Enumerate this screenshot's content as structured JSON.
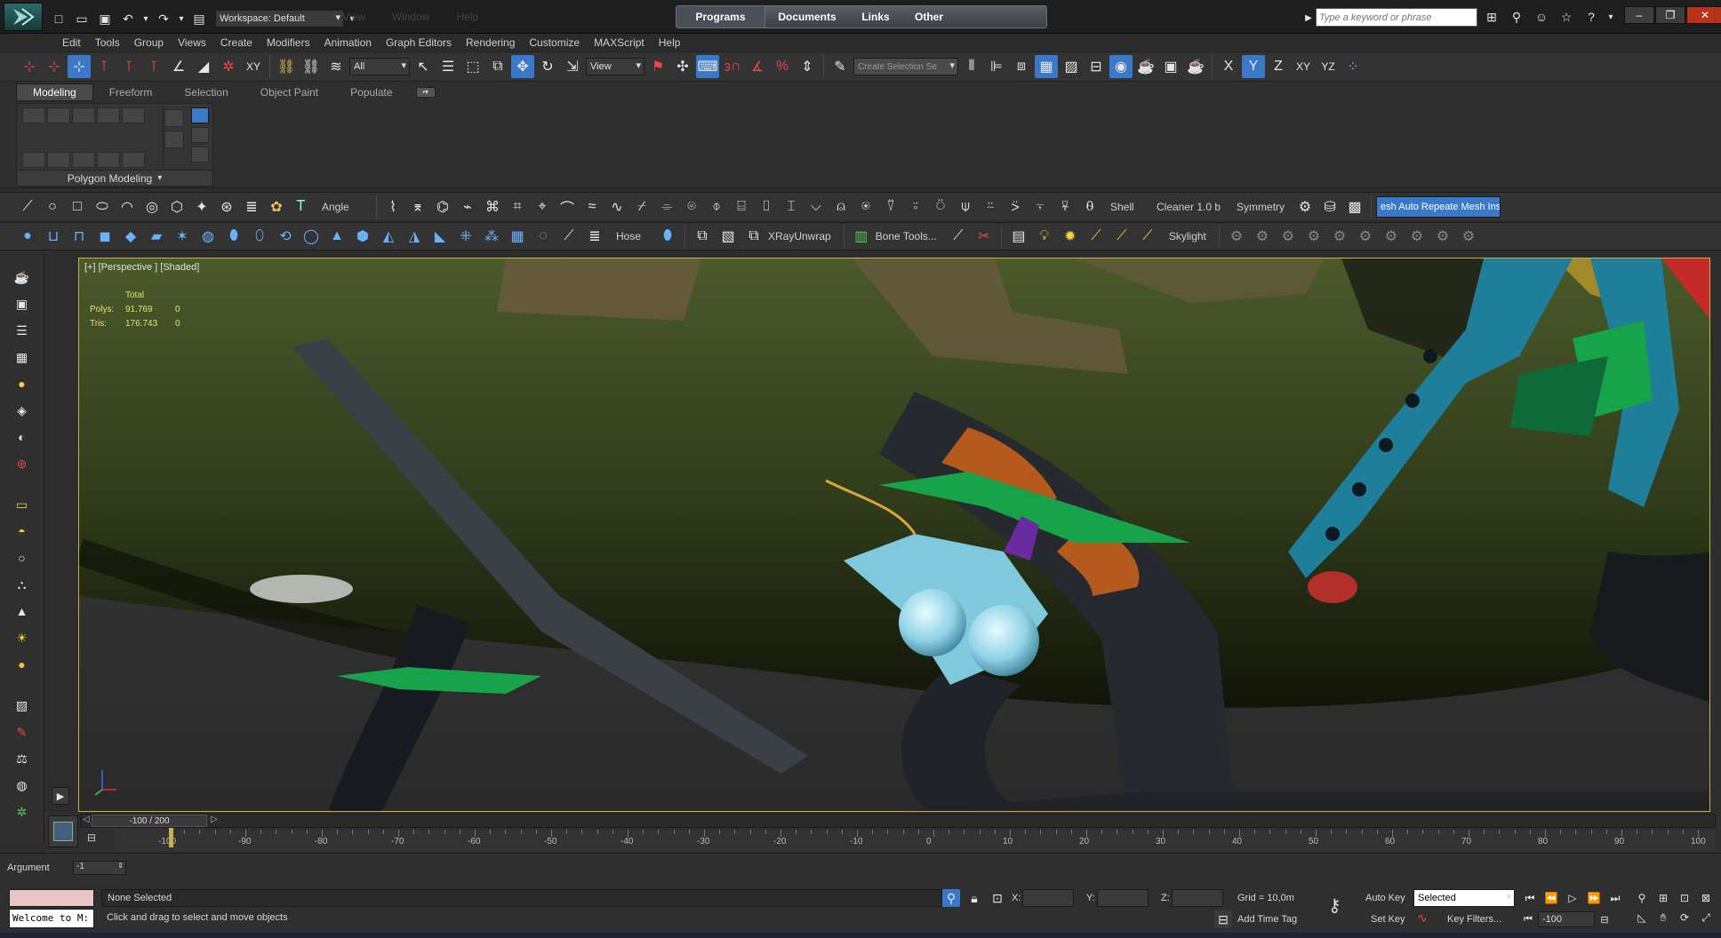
{
  "titlebar": {
    "workspace": "Workspace: Default",
    "faded": [
      "View",
      "Window",
      "Help"
    ],
    "tabs": [
      "Programs",
      "Documents",
      "Links",
      "Other"
    ],
    "search_placeholder": "Type a keyword or phrase"
  },
  "menubar": [
    "Edit",
    "Tools",
    "Group",
    "Views",
    "Create",
    "Modifiers",
    "Animation",
    "Graph Editors",
    "Rendering",
    "Customize",
    "MAXScript",
    "Help"
  ],
  "main_toolbar": {
    "filter": "All",
    "refcoord": "View",
    "selset": "Create Selection Se",
    "axes": [
      "X",
      "Y",
      "Z",
      "XY",
      "YZ"
    ],
    "snaps": [
      "3",
      "%"
    ]
  },
  "ribbon": {
    "tabs": [
      "Modeling",
      "Freeform",
      "Selection",
      "Object Paint",
      "Populate"
    ],
    "panel": "Polygon Modeling"
  },
  "tb1": {
    "angle": "Angle",
    "shell": "Shell",
    "cleaner": "Cleaner 1.0 b",
    "symmetry": "Symmetry",
    "mesh": "esh Auto Repeate Mesh Insp"
  },
  "tb2": {
    "hose": "Hose",
    "xray": "XRayUnwrap",
    "bone": "Bone Tools...",
    "skylight": "Skylight"
  },
  "viewport": {
    "label": "[+] [Perspective ] [Shaded]",
    "stats_header": "Total",
    "stats": [
      {
        "name": "Polys:",
        "total": "91.769",
        "sel": "0"
      },
      {
        "name": "Tris:",
        "total": "176.743",
        "sel": "0"
      }
    ]
  },
  "timeline": {
    "frame": "-100 / 200",
    "ticks": [
      "-90",
      "-80",
      "-70",
      "-60",
      "-50",
      "-40",
      "-30",
      "-20",
      "-10",
      "0",
      "10",
      "20",
      "30",
      "40",
      "50",
      "60",
      "70",
      "80",
      "90",
      "100"
    ],
    "first_tick": "-100"
  },
  "argument": {
    "label": "Argument",
    "value": "-1"
  },
  "status": {
    "welcome": "Welcome to M:",
    "selection": "None Selected",
    "prompt": "Click and drag to select and move objects",
    "x": "X:",
    "y": "Y:",
    "z": "Z:",
    "grid": "Grid = 10,0m",
    "add_time_tag": "Add Time Tag",
    "auto_key": "Auto Key",
    "set_key": "Set Key",
    "key_mode": "Selected",
    "key_filters": "Key Filters...",
    "frame_field": "-100"
  },
  "colors": {
    "accent": "#3a78c8",
    "viewport_border": "#c9b04a",
    "fuselage": "#3b4a22",
    "teal": "#1f7f9a",
    "green": "#17a34a"
  }
}
